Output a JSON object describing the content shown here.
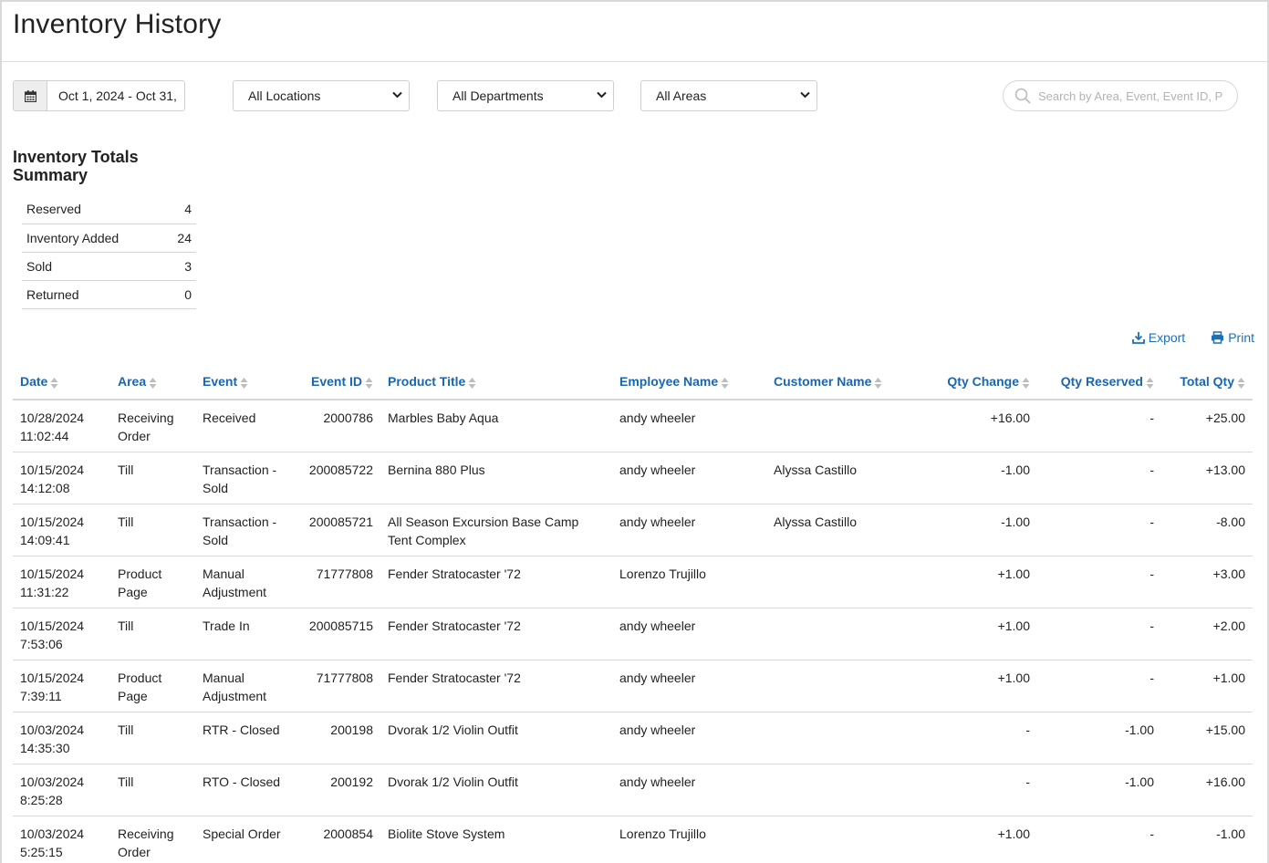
{
  "page": {
    "title": "Inventory History"
  },
  "filters": {
    "date_range": "Oct 1, 2024 - Oct 31,",
    "location": "All Locations",
    "department": "All Departments",
    "area": "All Areas",
    "search_placeholder": "Search by Area, Event, Event ID, P"
  },
  "summary": {
    "title_line1": "Inventory Totals",
    "title_line2": "Summary",
    "rows": [
      {
        "label": "Reserved",
        "value": "4"
      },
      {
        "label": "Inventory Added",
        "value": "24"
      },
      {
        "label": "Sold",
        "value": "3"
      },
      {
        "label": "Returned",
        "value": "0"
      }
    ]
  },
  "actions": {
    "export": "Export",
    "print": "Print"
  },
  "table": {
    "columns": [
      "Date",
      "Area",
      "Event",
      "Event ID",
      "Product Title",
      "Employee Name",
      "Customer Name",
      "Qty Change",
      "Qty Reserved",
      "Total Qty"
    ],
    "rows": [
      [
        "10/28/2024 11:02:44",
        "Receiving Order",
        "Received",
        "2000786",
        "Marbles Baby Aqua",
        "andy wheeler",
        "",
        "+16.00",
        "-",
        "+25.00"
      ],
      [
        "10/15/2024 14:12:08",
        "Till",
        "Transaction - Sold",
        "200085722",
        "Bernina 880 Plus",
        "andy wheeler",
        "Alyssa Castillo",
        "-1.00",
        "-",
        "+13.00"
      ],
      [
        "10/15/2024 14:09:41",
        "Till",
        "Transaction - Sold",
        "200085721",
        "All Season Excursion Base Camp Tent Complex",
        "andy wheeler",
        "Alyssa Castillo",
        "-1.00",
        "-",
        "-8.00"
      ],
      [
        "10/15/2024 11:31:22",
        "Product Page",
        "Manual Adjustment",
        "71777808",
        "Fender Stratocaster '72",
        "Lorenzo Trujillo",
        "",
        "+1.00",
        "-",
        "+3.00"
      ],
      [
        "10/15/2024 7:53:06",
        "Till",
        "Trade In",
        "200085715",
        "Fender Stratocaster '72",
        "andy wheeler",
        "",
        "+1.00",
        "-",
        "+2.00"
      ],
      [
        "10/15/2024 7:39:11",
        "Product Page",
        "Manual Adjustment",
        "71777808",
        "Fender Stratocaster '72",
        "andy wheeler",
        "",
        "+1.00",
        "-",
        "+1.00"
      ],
      [
        "10/03/2024 14:35:30",
        "Till",
        "RTR - Closed",
        "200198",
        "Dvorak 1/2 Violin Outfit",
        "andy wheeler",
        "",
        "-",
        "-1.00",
        "+15.00"
      ],
      [
        "10/03/2024 8:25:28",
        "Till",
        "RTO - Closed",
        "200192",
        "Dvorak 1/2 Violin Outfit",
        "andy wheeler",
        "",
        "-",
        "-1.00",
        "+16.00"
      ],
      [
        "10/03/2024 5:25:15",
        "Receiving Order",
        "Special Order",
        "2000854",
        "Biolite Stove System",
        "Lorenzo Trujillo",
        "",
        "+1.00",
        "-",
        "-1.00"
      ]
    ]
  },
  "colors": {
    "link": "#1a66b0",
    "border": "#d9d9d9"
  }
}
